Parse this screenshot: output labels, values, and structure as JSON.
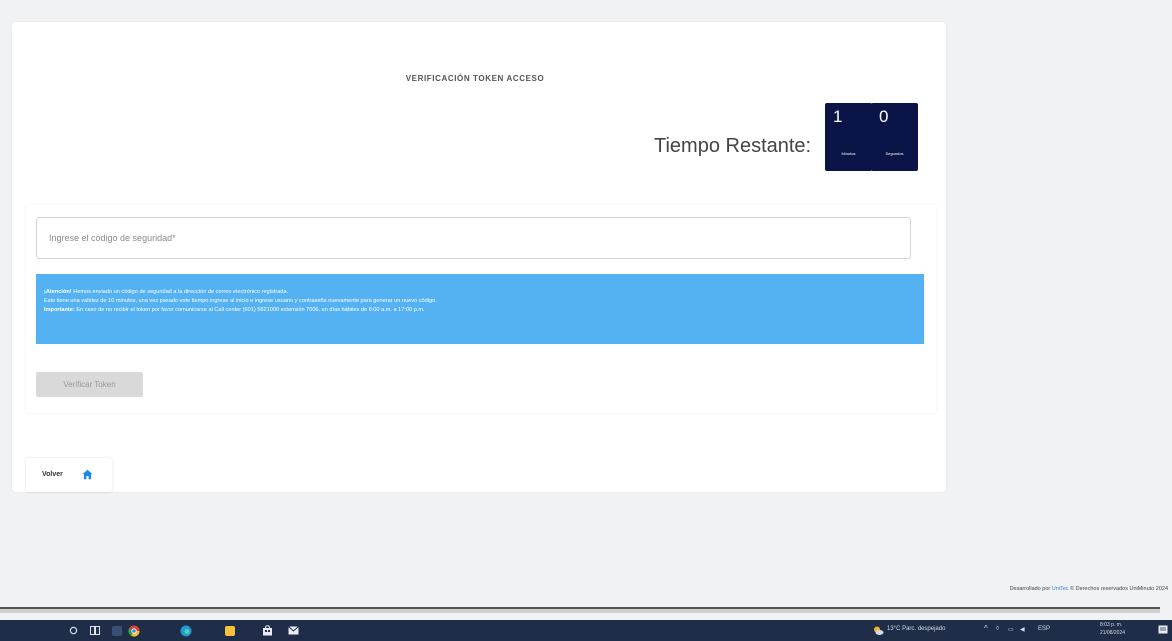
{
  "card": {
    "title": "VERIFICACIÓN TOKEN ACCESO",
    "timer_label": "Tiempo Restante:",
    "timer": {
      "minutes_value": "1",
      "minutes_unit": "Minutos",
      "seconds_value": "0",
      "seconds_unit": "Segundos"
    }
  },
  "form": {
    "code_placeholder": "Ingrese el código de seguridad*",
    "info": {
      "line1_strong": "¡Atención!",
      "line1": " Hemos enviado un código de seguridad a la dirección de correo electrónico registrada.",
      "line2": "Este tiene una validez de 10 minutos, una vez pasado este tiempo ingrese al inicio e ingrese usuario y contraseña nuevamente para generar un nuevo código.",
      "line3_strong": "Importante:",
      "line3": " En caso de no recibir el token por favor comunicarse al Call center (601) 5821000 extensión 7006, en días hábiles de 8:00 a.m. a 17:00 p.m."
    },
    "verify_label": "Verificar Token"
  },
  "back_label": "Volver",
  "footer": {
    "prefix": "Desarrollado por ",
    "link": "UniTec",
    "suffix": " © Derechos reservados UniMinuto 2024"
  },
  "taskbar": {
    "weather": "13°C Parc. despejado",
    "lang": "ESP",
    "time": "8:03 p. m.",
    "date": "21/08/2024"
  },
  "colors": {
    "timer_bg": "#0b1446",
    "info_bg": "#54b2f3",
    "home_icon": "#1e88e5"
  }
}
